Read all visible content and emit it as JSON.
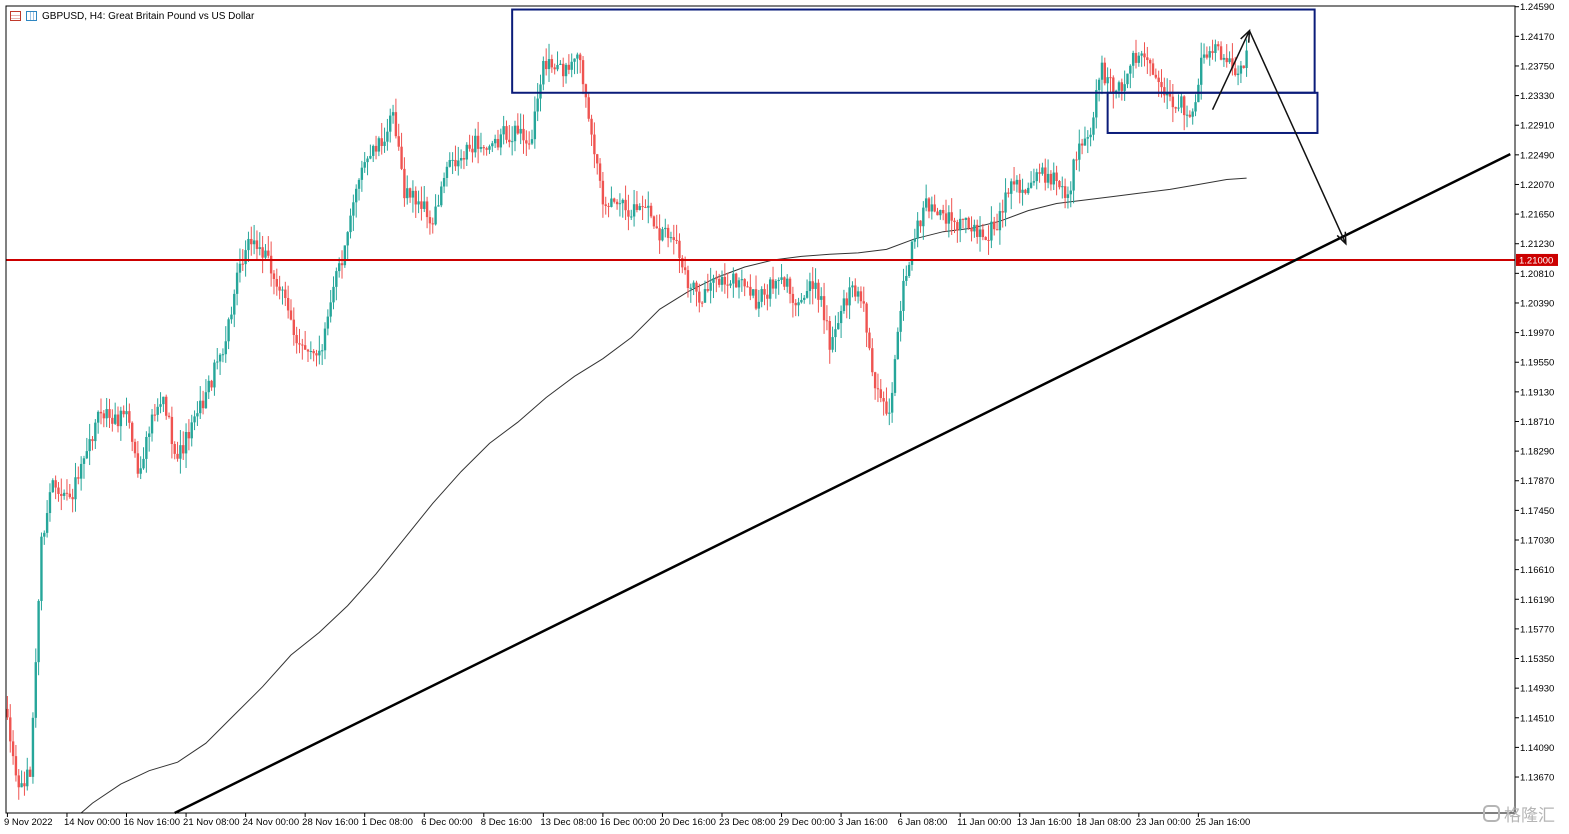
{
  "header": {
    "title": "GBPUSD, H4:  Great Britain Pound vs US Dollar"
  },
  "watermark": "格隆汇",
  "colors": {
    "bull": "#26a69a",
    "bear": "#ef5350",
    "resistance_line": "#cc0000",
    "zone_box": "#0b1c7a",
    "trend_line": "#000000",
    "moving_average": "#333333",
    "axis": "#000000",
    "price_label_bg": "#cc0000"
  },
  "chart_data": {
    "type": "candlestick",
    "symbol": "GBPUSD",
    "timeframe": "H4",
    "ylim": [
      1.1316,
      1.246
    ],
    "x_count": 438,
    "x_ticks": [
      {
        "i": 0,
        "label": "9 Nov 2022"
      },
      {
        "i": 21,
        "label": "14 Nov 00:00"
      },
      {
        "i": 42,
        "label": "16 Nov 16:00"
      },
      {
        "i": 63,
        "label": "21 Nov 08:00"
      },
      {
        "i": 84,
        "label": "24 Nov 00:00"
      },
      {
        "i": 105,
        "label": "28 Nov 16:00"
      },
      {
        "i": 126,
        "label": "1 Dec 08:00"
      },
      {
        "i": 147,
        "label": "6 Dec 00:00"
      },
      {
        "i": 168,
        "label": "8 Dec 16:00"
      },
      {
        "i": 189,
        "label": "13 Dec 08:00"
      },
      {
        "i": 210,
        "label": "16 Dec 00:00"
      },
      {
        "i": 231,
        "label": "20 Dec 16:00"
      },
      {
        "i": 252,
        "label": "23 Dec 08:00"
      },
      {
        "i": 273,
        "label": "29 Dec 00:00"
      },
      {
        "i": 294,
        "label": "3 Jan 16:00"
      },
      {
        "i": 315,
        "label": "6 Jan 08:00"
      },
      {
        "i": 336,
        "label": "11 Jan 00:00"
      },
      {
        "i": 357,
        "label": "13 Jan 16:00"
      },
      {
        "i": 378,
        "label": "18 Jan 08:00"
      },
      {
        "i": 399,
        "label": "23 Jan 00:00"
      },
      {
        "i": 420,
        "label": "25 Jan 16:00"
      }
    ],
    "y_ticks": [
      "1.24590",
      "1.24170",
      "1.23750",
      "1.23330",
      "1.22910",
      "1.22490",
      "1.22070",
      "1.21650",
      "1.21230",
      "1.20810",
      "1.20390",
      "1.19970",
      "1.19550",
      "1.19130",
      "1.18710",
      "1.18290",
      "1.17870",
      "1.17450",
      "1.17030",
      "1.16610",
      "1.16190",
      "1.15770",
      "1.15350",
      "1.14930",
      "1.14510",
      "1.14090",
      "1.13670"
    ],
    "price_label": "1.21000",
    "anchors": [
      [
        0,
        1.144
      ],
      [
        4,
        1.135
      ],
      [
        8,
        1.137
      ],
      [
        12,
        1.17
      ],
      [
        16,
        1.179
      ],
      [
        22,
        1.176
      ],
      [
        28,
        1.182
      ],
      [
        33,
        1.189
      ],
      [
        38,
        1.187
      ],
      [
        42,
        1.189
      ],
      [
        46,
        1.18
      ],
      [
        51,
        1.187
      ],
      [
        55,
        1.19
      ],
      [
        60,
        1.182
      ],
      [
        66,
        1.187
      ],
      [
        72,
        1.193
      ],
      [
        77,
        1.199
      ],
      [
        81,
        1.207
      ],
      [
        86,
        1.213
      ],
      [
        90,
        1.211
      ],
      [
        96,
        1.206
      ],
      [
        101,
        1.2
      ],
      [
        106,
        1.196
      ],
      [
        111,
        1.198
      ],
      [
        115,
        1.207
      ],
      [
        119,
        1.211
      ],
      [
        125,
        1.224
      ],
      [
        131,
        1.226
      ],
      [
        136,
        1.23
      ],
      [
        140,
        1.22
      ],
      [
        146,
        1.218
      ],
      [
        150,
        1.215
      ],
      [
        155,
        1.223
      ],
      [
        160,
        1.224
      ],
      [
        165,
        1.227
      ],
      [
        170,
        1.225
      ],
      [
        175,
        1.228
      ],
      [
        180,
        1.228
      ],
      [
        185,
        1.227
      ],
      [
        189,
        1.238
      ],
      [
        193,
        1.237
      ],
      [
        197,
        1.237
      ],
      [
        201,
        1.24
      ],
      [
        206,
        1.229
      ],
      [
        210,
        1.217
      ],
      [
        215,
        1.219
      ],
      [
        220,
        1.217
      ],
      [
        225,
        1.218
      ],
      [
        230,
        1.214
      ],
      [
        235,
        1.214
      ],
      [
        240,
        1.206
      ],
      [
        245,
        1.205
      ],
      [
        250,
        1.207
      ],
      [
        255,
        1.207
      ],
      [
        260,
        1.207
      ],
      [
        264,
        1.204
      ],
      [
        269,
        1.206
      ],
      [
        274,
        1.207
      ],
      [
        279,
        1.204
      ],
      [
        283,
        1.206
      ],
      [
        287,
        1.205
      ],
      [
        290,
        1.198
      ],
      [
        294,
        1.203
      ],
      [
        298,
        1.206
      ],
      [
        302,
        1.204
      ],
      [
        306,
        1.191
      ],
      [
        311,
        1.188
      ],
      [
        315,
        1.204
      ],
      [
        319,
        1.212
      ],
      [
        324,
        1.218
      ],
      [
        329,
        1.217
      ],
      [
        334,
        1.215
      ],
      [
        339,
        1.215
      ],
      [
        344,
        1.213
      ],
      [
        349,
        1.215
      ],
      [
        354,
        1.222
      ],
      [
        359,
        1.22
      ],
      [
        364,
        1.222
      ],
      [
        369,
        1.222
      ],
      [
        374,
        1.219
      ],
      [
        378,
        1.227
      ],
      [
        382,
        1.229
      ],
      [
        386,
        1.237
      ],
      [
        391,
        1.233
      ],
      [
        396,
        1.238
      ],
      [
        401,
        1.239
      ],
      [
        405,
        1.237
      ],
      [
        410,
        1.233
      ],
      [
        414,
        1.232
      ],
      [
        418,
        1.231
      ],
      [
        421,
        1.238
      ],
      [
        425,
        1.24
      ],
      [
        430,
        1.238
      ],
      [
        434,
        1.237
      ],
      [
        437,
        1.239
      ]
    ],
    "moving_average": [
      [
        26,
        1.1316
      ],
      [
        30,
        1.133
      ],
      [
        40,
        1.1357
      ],
      [
        50,
        1.1376
      ],
      [
        60,
        1.1388
      ],
      [
        70,
        1.1415
      ],
      [
        80,
        1.1455
      ],
      [
        90,
        1.1495
      ],
      [
        100,
        1.154
      ],
      [
        110,
        1.1572
      ],
      [
        120,
        1.161
      ],
      [
        130,
        1.1655
      ],
      [
        140,
        1.1705
      ],
      [
        150,
        1.1755
      ],
      [
        160,
        1.18
      ],
      [
        170,
        1.184
      ],
      [
        180,
        1.187
      ],
      [
        190,
        1.1905
      ],
      [
        200,
        1.1935
      ],
      [
        210,
        1.196
      ],
      [
        220,
        1.199
      ],
      [
        230,
        1.203
      ],
      [
        240,
        1.2055
      ],
      [
        250,
        1.2075
      ],
      [
        260,
        1.209
      ],
      [
        270,
        1.21
      ],
      [
        280,
        1.2105
      ],
      [
        290,
        1.2108
      ],
      [
        300,
        1.211
      ],
      [
        310,
        1.2115
      ],
      [
        320,
        1.213
      ],
      [
        330,
        1.214
      ],
      [
        340,
        1.2145
      ],
      [
        350,
        1.2155
      ],
      [
        360,
        1.217
      ],
      [
        370,
        1.218
      ],
      [
        380,
        1.2185
      ],
      [
        390,
        1.219
      ],
      [
        400,
        1.2195
      ],
      [
        410,
        1.22
      ],
      [
        420,
        1.2207
      ],
      [
        430,
        1.2214
      ],
      [
        437,
        1.2216
      ]
    ],
    "horizontal_line": 1.21,
    "trend_line": [
      [
        59,
        1.1316
      ],
      [
        530,
        1.225
      ]
    ],
    "zones": [
      {
        "name": "supply-zone-top",
        "x0": 178,
        "x1": 461,
        "y0": 1.2455,
        "y1": 1.2337
      },
      {
        "name": "supply-zone-small",
        "x0": 388,
        "x1": 462,
        "y0": 1.2337,
        "y1": 1.228
      }
    ],
    "arrows": [
      {
        "from": [
          425,
          1.2313
        ],
        "to": [
          438,
          1.2425
        ]
      },
      {
        "from": [
          438,
          1.2425
        ],
        "to": [
          472,
          1.2123
        ]
      }
    ]
  }
}
